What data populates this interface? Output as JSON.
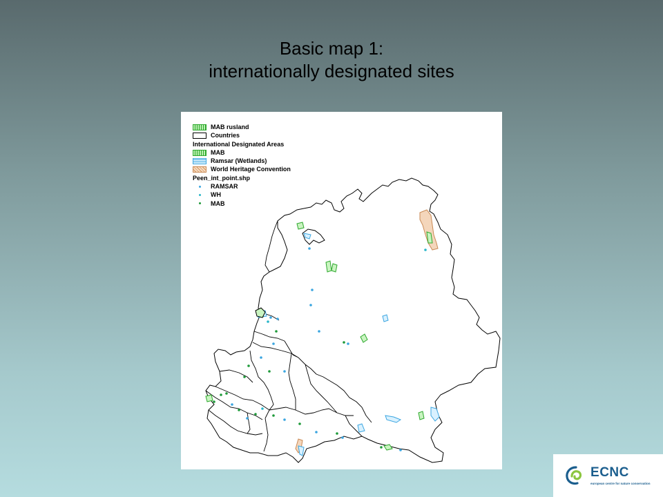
{
  "slide": {
    "title_line1": "Basic map 1:",
    "title_line2": "internationally designated sites"
  },
  "legend": {
    "items": [
      {
        "label": "MAB rusland",
        "kind": "mab-rusland"
      },
      {
        "label": "Countries",
        "kind": "countries"
      },
      {
        "label": "International Designated Areas",
        "kind": "header"
      },
      {
        "label": "MAB",
        "kind": "mab"
      },
      {
        "label": "Ramsar (Wetlands)",
        "kind": "ramsar"
      },
      {
        "label": "World Heritage Convention",
        "kind": "wh"
      },
      {
        "label": "Peen_int_point.shp",
        "kind": "header"
      },
      {
        "label": "RAMSAR",
        "kind": "point",
        "color": "#3aa5e0"
      },
      {
        "label": "WH",
        "kind": "point",
        "color": "#29b6c9"
      },
      {
        "label": "MAB",
        "kind": "point",
        "color": "#1f9a3a"
      }
    ]
  },
  "colors": {
    "mab": "#2ea82e",
    "ramsar": "#3aa5e0",
    "world_heritage": "#d59860",
    "country_border": "#000000"
  },
  "logo": {
    "wordmark_e": "E",
    "wordmark_rest": "CNC",
    "tagline": "european centre for nature conservation"
  }
}
